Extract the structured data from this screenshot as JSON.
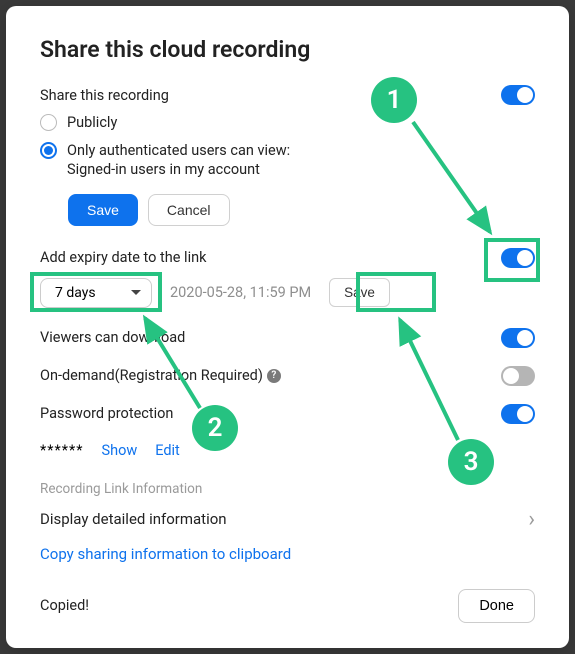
{
  "modal": {
    "title": "Share this cloud recording",
    "share_label": "Share this recording",
    "radio_public": "Publicly",
    "radio_auth_line1": "Only authenticated users can view:",
    "radio_auth_line2": "Signed-in users in my account",
    "save_btn": "Save",
    "cancel_btn": "Cancel"
  },
  "expiry": {
    "label": "Add expiry date to the link",
    "select_value": "7 days",
    "date_text": "2020-05-28, 11:59 PM",
    "save_btn": "Save"
  },
  "options": {
    "download_label": "Viewers can download",
    "on_demand_label": "On-demand(Registration Required)",
    "password_label": "Password protection"
  },
  "password": {
    "masked": "******",
    "show": "Show",
    "edit": "Edit"
  },
  "link_info": {
    "header": "Recording Link Information",
    "detail": "Display detailed information",
    "copy": "Copy sharing information to clipboard"
  },
  "footer": {
    "copied": "Copied!",
    "done": "Done"
  },
  "annotations": {
    "n1": "1",
    "n2": "2",
    "n3": "3"
  }
}
